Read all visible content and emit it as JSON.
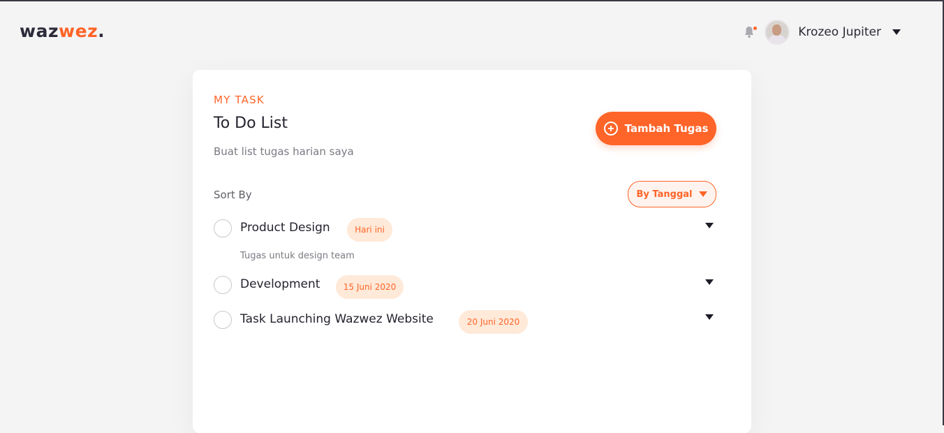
{
  "brand": {
    "part1": "waz",
    "part2": "wez",
    "dot": ".",
    "accent_color": "#ff6428"
  },
  "header": {
    "user_name": "Krozeo Jupiter",
    "bell_icon": "bell-icon",
    "dropdown_icon": "caret-down-icon"
  },
  "card": {
    "eyebrow": "MY TASK",
    "title": "To Do List",
    "subtitle": "Buat list tugas harian saya",
    "add_button": "Tambah Tugas",
    "sort_label": "Sort By",
    "sort_value": "By Tanggal"
  },
  "tasks": [
    {
      "name": "Product Design",
      "badge": "Hari ini",
      "description": "Tugas untuk design team"
    },
    {
      "name": "Development",
      "badge": "15 Juni 2020"
    },
    {
      "name": "Task Launching Wazwez Website",
      "badge": "20 Juni 2020"
    }
  ]
}
